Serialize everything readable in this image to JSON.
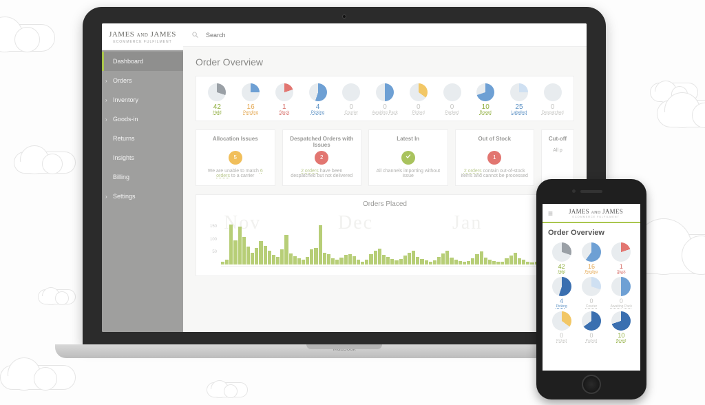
{
  "brand": {
    "name_a": "JAMES",
    "and": "AND",
    "name_b": "JAMES",
    "tag": "ECOMMERCE FULFILMENT"
  },
  "search": {
    "placeholder": "Search"
  },
  "nav": {
    "items": [
      {
        "label": "Dashboard",
        "active": true,
        "has_children": false
      },
      {
        "label": "Orders",
        "active": false,
        "has_children": true
      },
      {
        "label": "Inventory",
        "active": false,
        "has_children": true
      },
      {
        "label": "Goods-in",
        "active": false,
        "has_children": true
      },
      {
        "label": "Returns",
        "active": false,
        "has_children": false
      },
      {
        "label": "Insights",
        "active": false,
        "has_children": false
      },
      {
        "label": "Billing",
        "active": false,
        "has_children": false
      },
      {
        "label": "Settings",
        "active": false,
        "has_children": true
      }
    ]
  },
  "overview_title": "Order Overview",
  "pies": [
    {
      "num": "42",
      "label": "Held",
      "ncolor": "#8fae3e",
      "slice": 30,
      "color": "#9aa0a6"
    },
    {
      "num": "16",
      "label": "Pending",
      "ncolor": "#e4a853",
      "slice": 25,
      "color": "#6ea0d4"
    },
    {
      "num": "1",
      "label": "Stuck",
      "ncolor": "#d76d67",
      "slice": 20,
      "color": "#e27671"
    },
    {
      "num": "4",
      "label": "Picking",
      "ncolor": "#5c91c4",
      "slice": 55,
      "color": "#6ea0d4"
    },
    {
      "num": "0",
      "label": "Courier",
      "ncolor": "#c5c5c2",
      "slice": 0,
      "color": "#e8ecef"
    },
    {
      "num": "0",
      "label": "Awaiting Pack",
      "ncolor": "#c5c5c2",
      "slice": 50,
      "color": "#6ea0d4"
    },
    {
      "num": "0",
      "label": "Picked",
      "ncolor": "#c5c5c2",
      "slice": 35,
      "color": "#f2c766"
    },
    {
      "num": "0",
      "label": "Packed",
      "ncolor": "#c5c5c2",
      "slice": 0,
      "color": "#e8ecef"
    },
    {
      "num": "10",
      "label": "Boxed",
      "ncolor": "#8fae3e",
      "slice": 70,
      "color": "#6ea0d4"
    },
    {
      "num": "25",
      "label": "Labelled",
      "ncolor": "#5c91c4",
      "slice": 25,
      "color": "#cfe0f2"
    },
    {
      "num": "0",
      "label": "Despatched",
      "ncolor": "#c5c5c2",
      "slice": 0,
      "color": "#e8ecef"
    }
  ],
  "status": [
    {
      "title": "Allocation Issues",
      "badge": "5",
      "bclass": "amber",
      "pre": "We are unable to match ",
      "link": "6 orders",
      "post": " to a carrier"
    },
    {
      "title": "Despatched Orders with Issues",
      "badge": "2",
      "bclass": "red",
      "pre": "",
      "link": "2 orders",
      "post": " have been despatched but not delivered"
    },
    {
      "title": "Latest In",
      "badge": "check",
      "bclass": "green",
      "pre": "All channels importing without issue",
      "link": "",
      "post": ""
    },
    {
      "title": "Out of Stock",
      "badge": "1",
      "bclass": "red",
      "pre": "",
      "link": "2 orders",
      "post": " contain out-of-stock items and cannot be processed"
    },
    {
      "title": "Cut-off",
      "badge": "",
      "bclass": "",
      "pre": "All p",
      "link": "",
      "post": ""
    }
  ],
  "orders_placed": {
    "title": "Orders Placed"
  },
  "chart_data": {
    "type": "bar",
    "title": "Orders Placed",
    "xlabel": "",
    "ylabel": "",
    "categories_months": [
      "Nov",
      "Dec",
      "Jan"
    ],
    "y_ticks": [
      50,
      100,
      150
    ],
    "ylim": [
      0,
      170
    ],
    "values": [
      12,
      18,
      160,
      95,
      150,
      110,
      70,
      48,
      65,
      92,
      74,
      55,
      38,
      30,
      60,
      118,
      45,
      34,
      26,
      20,
      30,
      60,
      66,
      155,
      48,
      40,
      26,
      20,
      28,
      38,
      42,
      34,
      18,
      12,
      18,
      42,
      55,
      62,
      38,
      30,
      22,
      16,
      22,
      36,
      48,
      55,
      30,
      22,
      16,
      12,
      16,
      30,
      44,
      56,
      28,
      20,
      14,
      10,
      14,
      26,
      40,
      52,
      28,
      20,
      14,
      10,
      12,
      24,
      36,
      48,
      26,
      18,
      12,
      8,
      12,
      22,
      34,
      46,
      24,
      16,
      10
    ]
  },
  "laptop_label": "MacBook",
  "phone": {
    "pies": [
      {
        "num": "42",
        "label": "Held",
        "ncolor": "#8fae3e",
        "slice": 30,
        "color": "#9aa0a6"
      },
      {
        "num": "16",
        "label": "Pending",
        "ncolor": "#e4a853",
        "slice": 60,
        "color": "#6ea0d4"
      },
      {
        "num": "1",
        "label": "Stuck",
        "ncolor": "#d76d67",
        "slice": 20,
        "color": "#e27671"
      },
      {
        "num": "4",
        "label": "Picking",
        "ncolor": "#5c91c4",
        "slice": 55,
        "color": "#3a6fb0"
      },
      {
        "num": "0",
        "label": "Courier",
        "ncolor": "#c5c5c2",
        "slice": 30,
        "color": "#cfe0f2"
      },
      {
        "num": "0",
        "label": "Awaiting Pack",
        "ncolor": "#c5c5c2",
        "slice": 50,
        "color": "#6ea0d4"
      },
      {
        "num": "0",
        "label": "Picked",
        "ncolor": "#c5c5c2",
        "slice": 35,
        "color": "#f2c766"
      },
      {
        "num": "0",
        "label": "Packed",
        "ncolor": "#c5c5c2",
        "slice": 65,
        "color": "#3a6fb0"
      },
      {
        "num": "10",
        "label": "Boxed",
        "ncolor": "#8fae3e",
        "slice": 70,
        "color": "#3a6fb0"
      }
    ]
  }
}
